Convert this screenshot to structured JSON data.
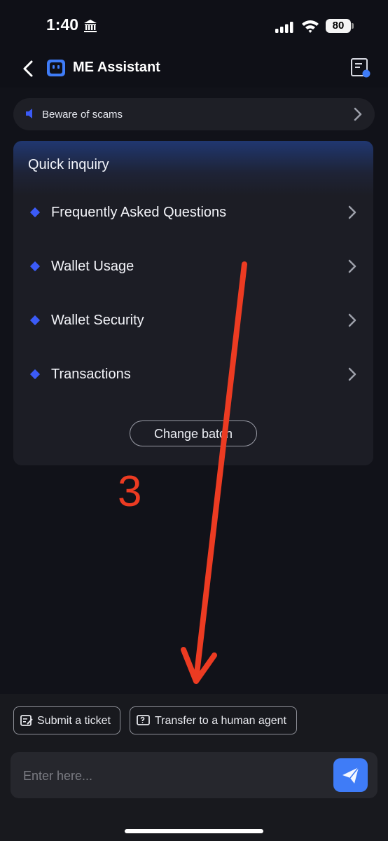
{
  "status_bar": {
    "time": "1:40",
    "battery": "80"
  },
  "header": {
    "title": "ME Assistant"
  },
  "notice": {
    "text": "Beware of scams"
  },
  "quick_inquiry": {
    "title": "Quick inquiry",
    "items": [
      {
        "label": "Frequently Asked Questions"
      },
      {
        "label": "Wallet Usage"
      },
      {
        "label": "Wallet Security"
      },
      {
        "label": "Transactions"
      }
    ],
    "change_button": "Change batch"
  },
  "annotation": {
    "number": "3"
  },
  "actions": {
    "submit_ticket": "Submit a ticket",
    "transfer_human": "Transfer to a human agent"
  },
  "input": {
    "placeholder": "Enter here..."
  },
  "colors": {
    "accent": "#3f7cf7",
    "diamond": "#3b5bf7",
    "annotation": "#ec3b22"
  }
}
